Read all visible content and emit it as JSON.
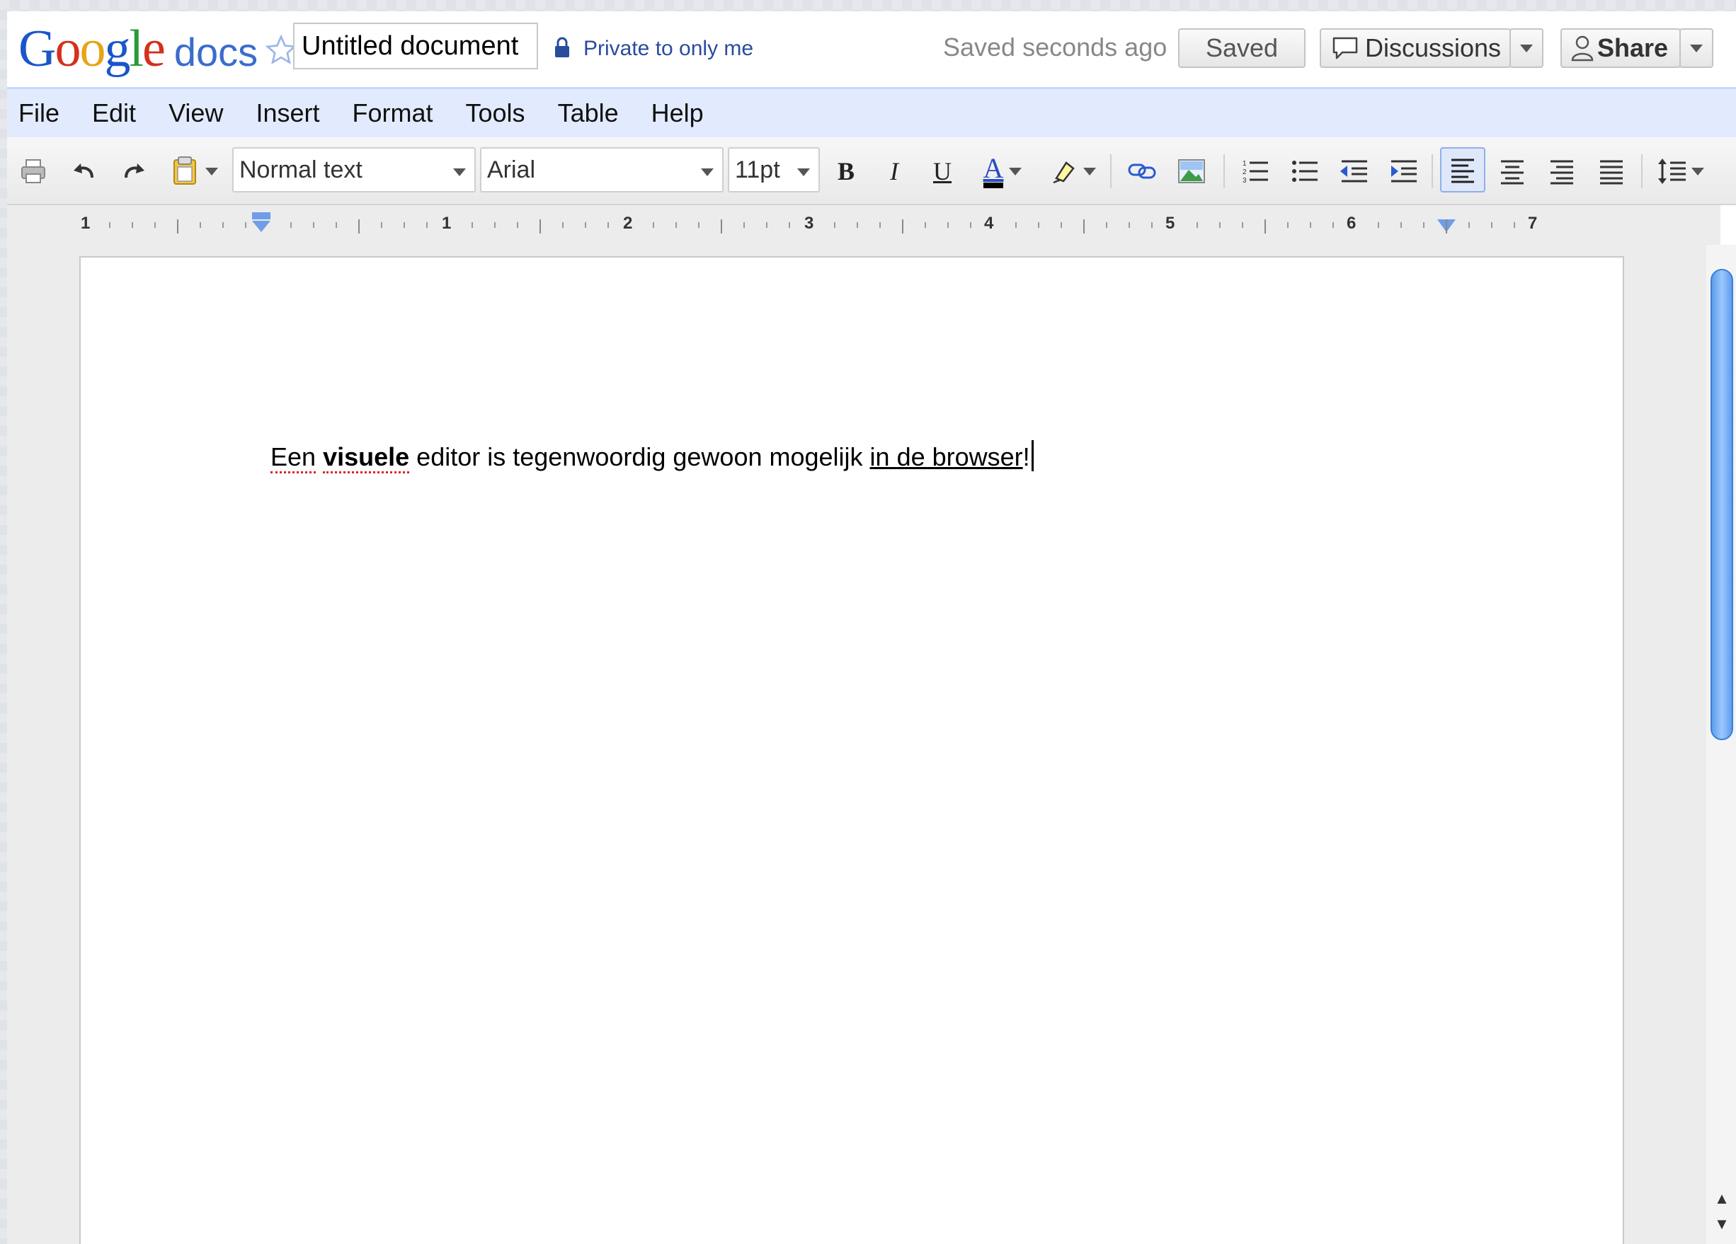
{
  "header": {
    "logo_google": "Google",
    "logo_docs": "docs",
    "doc_title": "Untitled document",
    "privacy": "Private to only me",
    "save_status": "Saved seconds ago",
    "saved_button": "Saved",
    "discussions_button": "Discussions",
    "share_button": "Share"
  },
  "menu": [
    "File",
    "Edit",
    "View",
    "Insert",
    "Format",
    "Tools",
    "Table",
    "Help"
  ],
  "toolbar": {
    "style_value": "Normal text",
    "font_value": "Arial",
    "size_value": "11pt",
    "bold_label": "B",
    "italic_label": "I",
    "underline_label": "U",
    "text_color_label": "A"
  },
  "ruler": {
    "labels": [
      "1",
      "1",
      "2",
      "3",
      "4",
      "5",
      "6",
      "7"
    ]
  },
  "document": {
    "seg1": "Een",
    "seg2": "visuele",
    "seg3": " editor is tegenwoordig gewoon mogelijk ",
    "seg4": "in de browser",
    "seg5": "!"
  },
  "colors": {
    "menubar_bg": "#e2ebfd",
    "accent_blue": "#3a6ccc",
    "link_blue": "#2a4c9e"
  }
}
